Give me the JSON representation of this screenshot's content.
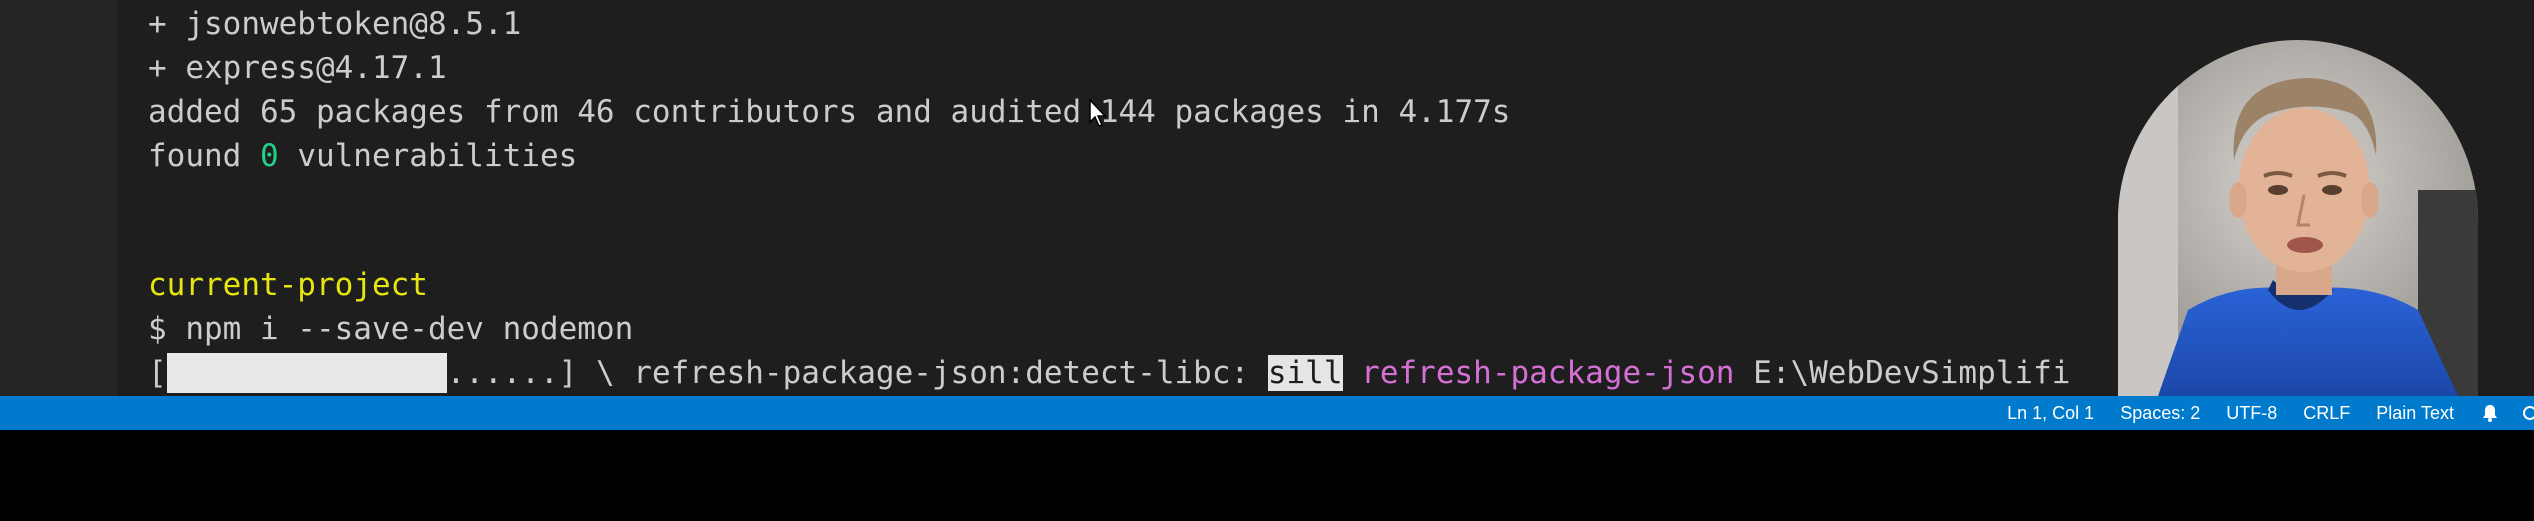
{
  "terminal": {
    "lines": {
      "pkg1": "+ jsonwebtoken@8.5.1",
      "pkg2": "+ express@4.17.1",
      "summary": "added 65 packages from 46 contributors and audited 144 packages in 4.177s",
      "found_prefix": "found ",
      "found_count": "0",
      "found_suffix": " vulnerabilities",
      "project": "current-project",
      "command": "$ npm i --save-dev nodemon",
      "progress_open": "[",
      "progress_filled": "               ",
      "progress_dots": "......",
      "progress_close": "] \\ refresh-package-json:detect-libc: ",
      "log_level": "sill",
      "log_name": "refresh-package-json",
      "log_path": " E:\\WebDevSimplifi        c-pr"
    },
    "progress_fraction": 0.68
  },
  "statusbar": {
    "position": "Ln 1, Col 1",
    "spaces": "Spaces: 2",
    "encoding": "UTF-8",
    "eol": "CRLF",
    "language": "Plain Text"
  },
  "icons": {
    "bell": "bell-icon",
    "pointer": "mouse-pointer-icon"
  },
  "colors": {
    "terminal_bg": "#1e1e1e",
    "statusbar_bg": "#007acc",
    "green": "#23d18b",
    "yellow": "#e5e510",
    "magenta": "#d670d6"
  }
}
